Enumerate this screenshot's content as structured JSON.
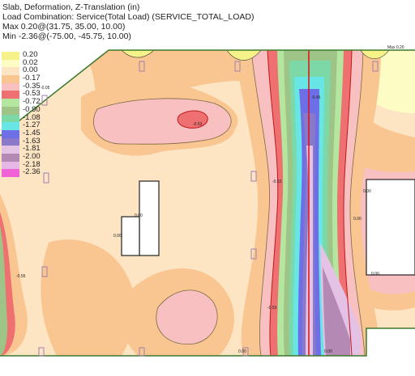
{
  "header": {
    "line1": "Slab, Deformation, Z-Translation (in)",
    "line2": "Load Combination: Service(Total Load) (SERVICE_TOTAL_LOAD)",
    "line3": "Max 0.20@(31.75, 35.00, 10.00)",
    "line4": "Min -2.36@(-75.00, -45.75, 10.00)"
  },
  "legend": [
    {
      "label": "0.20",
      "color": "#f6f28a"
    },
    {
      "label": "0.02",
      "color": "#fcfcc4"
    },
    {
      "label": "0.00",
      "color": "#fde4c2"
    },
    {
      "label": "-0.17",
      "color": "#f9c692"
    },
    {
      "label": "-0.35",
      "color": "#f8c0c0"
    },
    {
      "label": "-0.53",
      "color": "#ef7070"
    },
    {
      "label": "-0.72",
      "color": "#b4e6a0"
    },
    {
      "label": "-0.90",
      "color": "#9fc487"
    },
    {
      "label": "-1.08",
      "color": "#7cd8a6"
    },
    {
      "label": "-1.27",
      "color": "#68e6e6"
    },
    {
      "label": "-1.45",
      "color": "#6e6ee6"
    },
    {
      "label": "-1.63",
      "color": "#8a78c8"
    },
    {
      "label": "-1.81",
      "color": "#e4c2e6"
    },
    {
      "label": "-2.00",
      "color": "#b48ab4"
    },
    {
      "label": "-2.18",
      "color": "#e6b8e6"
    },
    {
      "label": "-2.36",
      "color": "#f063d8"
    }
  ],
  "contour_labels": [
    "-0.53",
    "-0.45",
    "-0.53",
    "-0.55",
    "0.00",
    "0.00",
    "-0.53",
    "0.00",
    "0.00",
    "-0.05",
    "0.00",
    "0.00",
    "0.00",
    "Max 0.20"
  ]
}
